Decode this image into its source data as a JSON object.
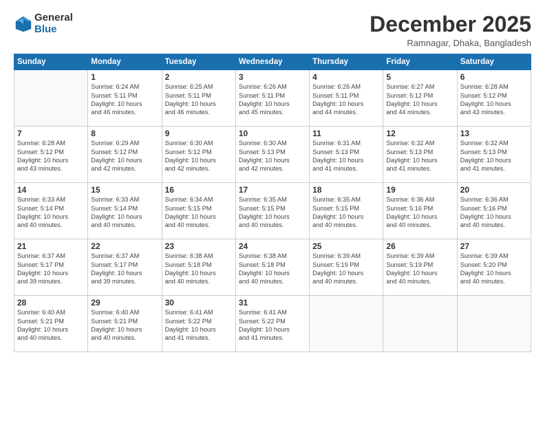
{
  "logo": {
    "general": "General",
    "blue": "Blue"
  },
  "title": {
    "month": "December 2025",
    "location": "Ramnagar, Dhaka, Bangladesh"
  },
  "headers": [
    "Sunday",
    "Monday",
    "Tuesday",
    "Wednesday",
    "Thursday",
    "Friday",
    "Saturday"
  ],
  "weeks": [
    [
      {
        "day": "",
        "info": ""
      },
      {
        "day": "1",
        "info": "Sunrise: 6:24 AM\nSunset: 5:11 PM\nDaylight: 10 hours\nand 46 minutes."
      },
      {
        "day": "2",
        "info": "Sunrise: 6:25 AM\nSunset: 5:11 PM\nDaylight: 10 hours\nand 46 minutes."
      },
      {
        "day": "3",
        "info": "Sunrise: 6:26 AM\nSunset: 5:11 PM\nDaylight: 10 hours\nand 45 minutes."
      },
      {
        "day": "4",
        "info": "Sunrise: 6:26 AM\nSunset: 5:11 PM\nDaylight: 10 hours\nand 44 minutes."
      },
      {
        "day": "5",
        "info": "Sunrise: 6:27 AM\nSunset: 5:12 PM\nDaylight: 10 hours\nand 44 minutes."
      },
      {
        "day": "6",
        "info": "Sunrise: 6:28 AM\nSunset: 5:12 PM\nDaylight: 10 hours\nand 43 minutes."
      }
    ],
    [
      {
        "day": "7",
        "info": "Sunrise: 6:28 AM\nSunset: 5:12 PM\nDaylight: 10 hours\nand 43 minutes."
      },
      {
        "day": "8",
        "info": "Sunrise: 6:29 AM\nSunset: 5:12 PM\nDaylight: 10 hours\nand 42 minutes."
      },
      {
        "day": "9",
        "info": "Sunrise: 6:30 AM\nSunset: 5:12 PM\nDaylight: 10 hours\nand 42 minutes."
      },
      {
        "day": "10",
        "info": "Sunrise: 6:30 AM\nSunset: 5:13 PM\nDaylight: 10 hours\nand 42 minutes."
      },
      {
        "day": "11",
        "info": "Sunrise: 6:31 AM\nSunset: 5:13 PM\nDaylight: 10 hours\nand 41 minutes."
      },
      {
        "day": "12",
        "info": "Sunrise: 6:32 AM\nSunset: 5:13 PM\nDaylight: 10 hours\nand 41 minutes."
      },
      {
        "day": "13",
        "info": "Sunrise: 6:32 AM\nSunset: 5:13 PM\nDaylight: 10 hours\nand 41 minutes."
      }
    ],
    [
      {
        "day": "14",
        "info": "Sunrise: 6:33 AM\nSunset: 5:14 PM\nDaylight: 10 hours\nand 40 minutes."
      },
      {
        "day": "15",
        "info": "Sunrise: 6:33 AM\nSunset: 5:14 PM\nDaylight: 10 hours\nand 40 minutes."
      },
      {
        "day": "16",
        "info": "Sunrise: 6:34 AM\nSunset: 5:15 PM\nDaylight: 10 hours\nand 40 minutes."
      },
      {
        "day": "17",
        "info": "Sunrise: 6:35 AM\nSunset: 5:15 PM\nDaylight: 10 hours\nand 40 minutes."
      },
      {
        "day": "18",
        "info": "Sunrise: 6:35 AM\nSunset: 5:15 PM\nDaylight: 10 hours\nand 40 minutes."
      },
      {
        "day": "19",
        "info": "Sunrise: 6:36 AM\nSunset: 5:16 PM\nDaylight: 10 hours\nand 40 minutes."
      },
      {
        "day": "20",
        "info": "Sunrise: 6:36 AM\nSunset: 5:16 PM\nDaylight: 10 hours\nand 40 minutes."
      }
    ],
    [
      {
        "day": "21",
        "info": "Sunrise: 6:37 AM\nSunset: 5:17 PM\nDaylight: 10 hours\nand 39 minutes."
      },
      {
        "day": "22",
        "info": "Sunrise: 6:37 AM\nSunset: 5:17 PM\nDaylight: 10 hours\nand 39 minutes."
      },
      {
        "day": "23",
        "info": "Sunrise: 6:38 AM\nSunset: 5:18 PM\nDaylight: 10 hours\nand 40 minutes."
      },
      {
        "day": "24",
        "info": "Sunrise: 6:38 AM\nSunset: 5:18 PM\nDaylight: 10 hours\nand 40 minutes."
      },
      {
        "day": "25",
        "info": "Sunrise: 6:39 AM\nSunset: 5:19 PM\nDaylight: 10 hours\nand 40 minutes."
      },
      {
        "day": "26",
        "info": "Sunrise: 6:39 AM\nSunset: 5:19 PM\nDaylight: 10 hours\nand 40 minutes."
      },
      {
        "day": "27",
        "info": "Sunrise: 6:39 AM\nSunset: 5:20 PM\nDaylight: 10 hours\nand 40 minutes."
      }
    ],
    [
      {
        "day": "28",
        "info": "Sunrise: 6:40 AM\nSunset: 5:21 PM\nDaylight: 10 hours\nand 40 minutes."
      },
      {
        "day": "29",
        "info": "Sunrise: 6:40 AM\nSunset: 5:21 PM\nDaylight: 10 hours\nand 40 minutes."
      },
      {
        "day": "30",
        "info": "Sunrise: 6:41 AM\nSunset: 5:22 PM\nDaylight: 10 hours\nand 41 minutes."
      },
      {
        "day": "31",
        "info": "Sunrise: 6:41 AM\nSunset: 5:22 PM\nDaylight: 10 hours\nand 41 minutes."
      },
      {
        "day": "",
        "info": ""
      },
      {
        "day": "",
        "info": ""
      },
      {
        "day": "",
        "info": ""
      }
    ]
  ]
}
